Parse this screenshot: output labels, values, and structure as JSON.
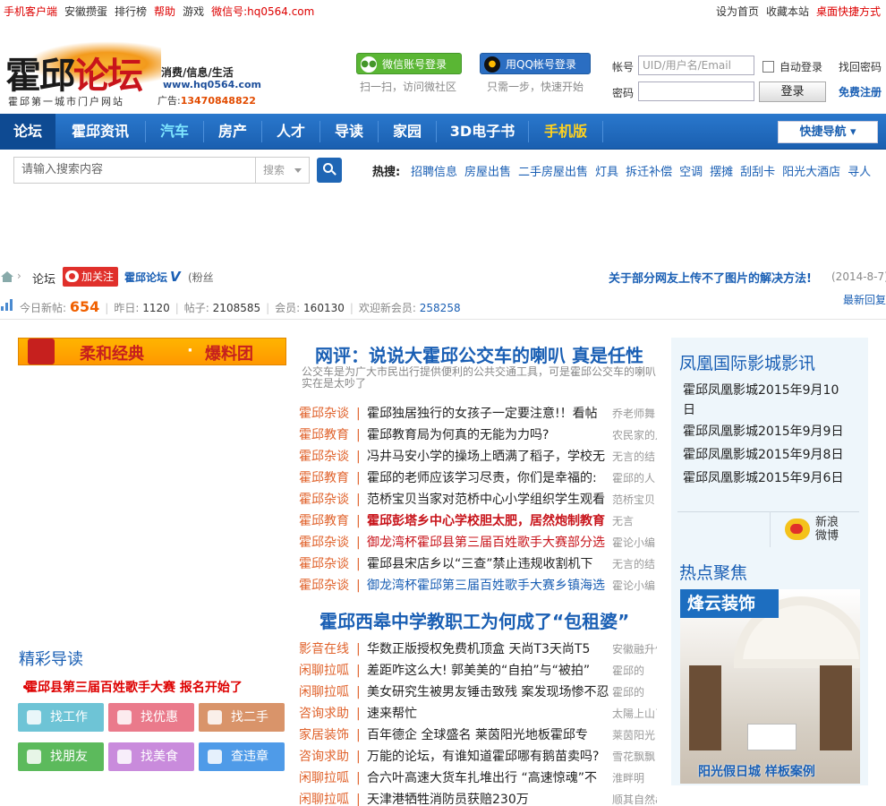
{
  "topbar": {
    "left": [
      {
        "label": "手机客户端",
        "red": true
      },
      {
        "label": "安徽攒蛋",
        "red": false
      },
      {
        "label": "排行榜",
        "red": false
      },
      {
        "label": "帮助",
        "red": true
      },
      {
        "label": "游戏",
        "red": false
      },
      {
        "label": "微信号:hq0564.com",
        "red": true
      }
    ],
    "right": [
      {
        "label": "设为首页",
        "red": false
      },
      {
        "label": "收藏本站",
        "red": false
      },
      {
        "label": "桌面快捷方式",
        "red": true
      }
    ]
  },
  "logo": {
    "main_a": "霍邱",
    "main_b": "论坛",
    "tagline": "消费/信息/生活",
    "url": "www.hq0564.com",
    "subtitle": "霍邱第一城市门户网站",
    "ad_label": "广告:",
    "ad_phone": "13470848822"
  },
  "login": {
    "wechat_label": "微信账号登录",
    "wechat_hint": "扫一扫，访问微社区",
    "qq_label": "用QQ帐号登录",
    "qq_hint": "只需一步，快速开始",
    "account_label": "帐号",
    "account_placeholder": "UID/用户名/Email",
    "password_label": "密码",
    "remember_label": "自动登录",
    "forgot_label": "找回密码",
    "login_label": "登录",
    "register_label": "免费注册"
  },
  "nav": {
    "items": [
      {
        "label": "论坛",
        "color": "#ffffff"
      },
      {
        "label": "霍邱资讯",
        "color": "#ffffff"
      },
      {
        "label": "汽车",
        "color": "#7fe6ff"
      },
      {
        "label": "房产",
        "color": "#ffffff"
      },
      {
        "label": "人才",
        "color": "#ffffff"
      },
      {
        "label": "导读",
        "color": "#ffffff"
      },
      {
        "label": "家园",
        "color": "#ffffff"
      },
      {
        "label": "3D电子书",
        "color": "#ffffff"
      },
      {
        "label": "手机版",
        "color": "#ffd21f"
      }
    ],
    "quick_nav": "快捷导航"
  },
  "search": {
    "placeholder": "请输入搜索内容",
    "type": "搜索",
    "hot_label": "热搜:",
    "hot": [
      "招聘信息",
      "房屋出售",
      "二手房屋出售",
      "灯具",
      "拆迁补偿",
      "空调",
      "摆摊",
      "刮刮卡",
      "阳光大酒店",
      "寻人"
    ]
  },
  "breadcrumb": {
    "forum": "论坛",
    "follow": "加关注",
    "weibo_name": "霍邱论坛",
    "v": "V",
    "fans": "(粉丝",
    "notice": "关于部分网友上传不了图片的解决方法!",
    "notice_date": "(2014-8-7)"
  },
  "stats": {
    "today_label": "今日新帖:",
    "today": "654",
    "yesterday_label": "昨日:",
    "yesterday": "1120",
    "posts_label": "帖子:",
    "posts": "2108585",
    "members_label": "会员:",
    "members": "160130",
    "welcome_label": "欢迎新会员:",
    "newest": "258258",
    "latest_reply": "最新回复"
  },
  "left": {
    "banner_a": "柔和经典",
    "banner_dot": "·",
    "banner_b": "爆料团",
    "section_title": "精彩导读",
    "featured": "霍邱县第三届百姓歌手大赛  报名开始了",
    "quick": [
      {
        "label": "找工作",
        "color": "#6ec4d6"
      },
      {
        "label": "找优惠",
        "color": "#ea7a8b"
      },
      {
        "label": "找二手",
        "color": "#d9946a"
      },
      {
        "label": "找朋友",
        "color": "#5cba5c"
      },
      {
        "label": "找美食",
        "color": "#c98bdc"
      },
      {
        "label": "查违章",
        "color": "#4f9be8"
      }
    ]
  },
  "middle": {
    "headline1": "网评：说说大霍邱公交车的喇叭 真是任性",
    "summary": "公交车是为广大市民出行提供便利的公共交通工具，可是霍邱公交车的喇叭实在是太吵了",
    "list1": [
      {
        "cat": "霍邱杂谈",
        "title": "霍邱独居独行的女孩子一定要注意!！看帖",
        "author": "乔老师舞",
        "color": "#222222"
      },
      {
        "cat": "霍邱教育",
        "title": "霍邱教育局为何真的无能为力吗?",
        "author": "农民家的儿子",
        "color": "#222222"
      },
      {
        "cat": "霍邱杂谈",
        "title": "冯井马安小学的操场上晒满了稻子，学校无",
        "author": "无言的结",
        "color": "#222222"
      },
      {
        "cat": "霍邱教育",
        "title": "霍邱的老师应该学习尽责，你们是幸福的:",
        "author": "霍邱的人",
        "color": "#222222"
      },
      {
        "cat": "霍邱杂谈",
        "title": "范桥宝贝当家对范桥中心小学组织学生观看",
        "author": "范桥宝贝",
        "color": "#222222"
      },
      {
        "cat": "霍邱教育",
        "title": "霍邱彭塔乡中心学校胆太肥，居然炮制教育",
        "author": "无言",
        "color": "#c8141b",
        "bold": true
      },
      {
        "cat": "霍邱杂谈",
        "title": "御龙湾杯霍邱县第三届百姓歌手大赛部分选",
        "author": "霍论小编",
        "color": "#c8141b"
      },
      {
        "cat": "霍邱杂谈",
        "title": "霍邱县宋店乡以“三查”禁止违规收割机下",
        "author": "无言的结",
        "color": "#222222"
      },
      {
        "cat": "霍邱杂谈",
        "title": "御龙湾杯霍邱第三届百姓歌手大赛乡镇海选",
        "author": "霍论小编",
        "color": "#1a5fb4"
      }
    ],
    "headline2": "霍邱西皋中学教职工为何成了“包租婆”",
    "list2": [
      {
        "cat": "影音在线",
        "title": "华数正版授权免费机顶盒  天尚T3天尚T5",
        "author": "安徽融升信"
      },
      {
        "cat": "闲聊拉呱",
        "title": "差距咋这么大! 郭美美的“自拍”与“被拍”",
        "author": "霍邱的"
      },
      {
        "cat": "闲聊拉呱",
        "title": "美女研究生被男友锤击致残  案发现场惨不忍",
        "author": "霍邱的"
      },
      {
        "cat": "咨询求助",
        "title": "速来帮忙",
        "author": "太陽上山了"
      },
      {
        "cat": "家居装饰",
        "title": "百年德企  全球盛名  莱茵阳光地板霍邱专",
        "author": "莱茵阳光"
      },
      {
        "cat": "咨询求助",
        "title": "万能的论坛，有谁知道霍邱哪有鹅苗卖吗?",
        "author": "雪花飘飘"
      },
      {
        "cat": "闲聊拉呱",
        "title": "合六叶高速大货车扎堆出行  “高速惊魂”不",
        "author": "淮畔明"
      },
      {
        "cat": "闲聊拉呱",
        "title": "天津港牺牲消防员获赔230万",
        "author": "顺其自然a"
      }
    ]
  },
  "right": {
    "cinema_title": "凤凰国际影城影讯",
    "cinema": [
      "霍邱凤凰影城2015年9月10日",
      "霍邱凤凰影城2015年9月9日",
      "霍邱凤凰影城2015年9月8日",
      "霍邱凤凰影城2015年9月6日"
    ],
    "weibo": "新浪微博",
    "hot_title": "热点聚焦",
    "ad_head": "烽云装饰",
    "ad_foot": "阳光假日城 样板案例"
  }
}
